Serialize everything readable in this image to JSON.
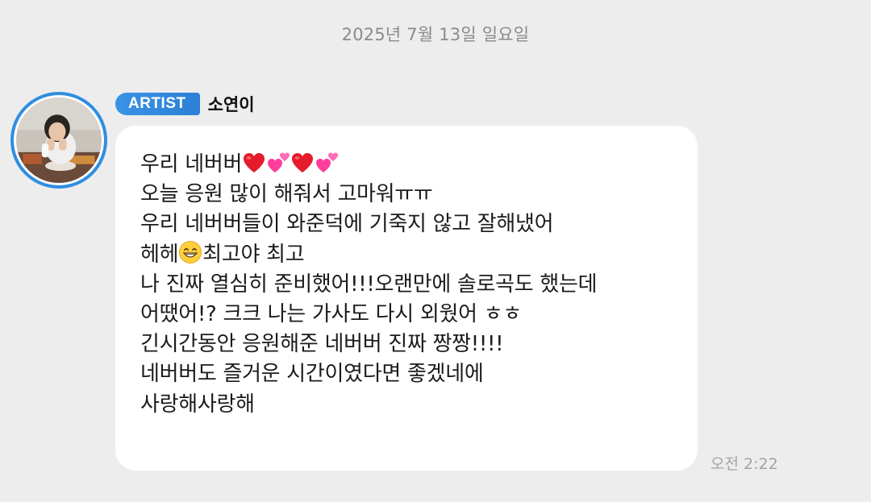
{
  "date_divider": "2025년 7월 13일 일요일",
  "sender": {
    "badge": "ARTIST",
    "name": "소연이"
  },
  "message": {
    "lines": [
      {
        "text_before": "우리 네버버",
        "emoji": [
          "red-heart-icon",
          "two-hearts-icon",
          "red-heart-icon",
          "two-hearts-icon"
        ],
        "text_after": ""
      },
      {
        "text_before": "오늘 응원 많이 해줘서 고마워ㅠㅠ"
      },
      {
        "text_before": "우리 네버버들이 와준덕에 기죽지 않고 잘해냈어"
      },
      {
        "text_before": "헤헤",
        "emoji": [
          "grinning-face-icon"
        ],
        "text_after": "최고야 최고"
      },
      {
        "text_before": "나 진짜 열심히 준비했어!!!오랜만에 솔로곡도 했는데"
      },
      {
        "text_before": "어땠어!? 크크 나는 가사도 다시 외웠어 ㅎㅎ"
      },
      {
        "text_before": "긴시간동안 응원해준 네버버 진짜 짱짱!!!!"
      },
      {
        "text_before": "네버버도 즐거운 시간이였다면 좋겠네에"
      },
      {
        "text_before": "사랑해사랑해"
      }
    ]
  },
  "timestamp": "오전 2:22",
  "colors": {
    "background": "#ededee",
    "bubble": "#ffffff",
    "badge": "#2f8ee0",
    "avatar_ring": "#2f8ee0",
    "heart_red": "#e31b2a",
    "heart_pink": "#ff4fa0",
    "muted_text": "#8a8a8a"
  }
}
